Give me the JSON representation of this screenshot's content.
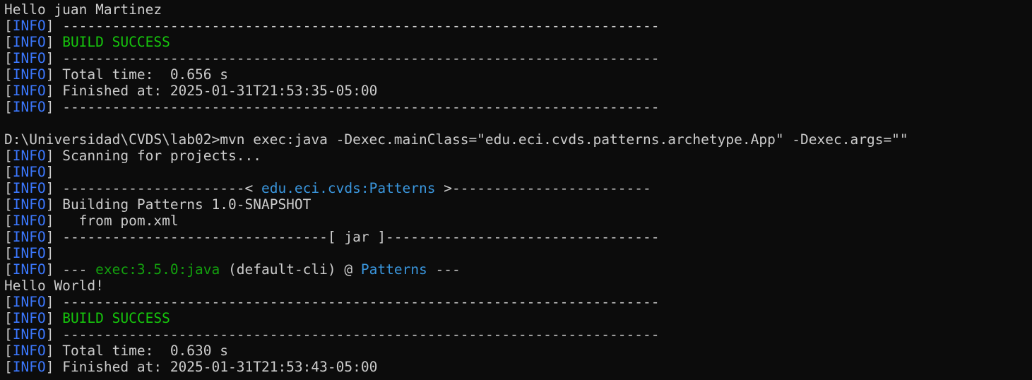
{
  "window": {
    "type": "terminal",
    "background": "#0c0c0c"
  },
  "colors": {
    "default": "#cccccc",
    "info_tag": "#3b78ff",
    "success": "#16c60c",
    "artifact": "#3a96dd",
    "plugin": "#13a10e"
  },
  "lines": [
    [
      {
        "t": "Hello juan Martinez",
        "c": "default"
      }
    ],
    [
      {
        "t": "[",
        "c": "default"
      },
      {
        "t": "INFO",
        "c": "blue"
      },
      {
        "t": "] ------------------------------------------------------------------------",
        "c": "default"
      }
    ],
    [
      {
        "t": "[",
        "c": "default"
      },
      {
        "t": "INFO",
        "c": "blue"
      },
      {
        "t": "] ",
        "c": "default"
      },
      {
        "t": "BUILD SUCCESS",
        "c": "green"
      }
    ],
    [
      {
        "t": "[",
        "c": "default"
      },
      {
        "t": "INFO",
        "c": "blue"
      },
      {
        "t": "] ------------------------------------------------------------------------",
        "c": "default"
      }
    ],
    [
      {
        "t": "[",
        "c": "default"
      },
      {
        "t": "INFO",
        "c": "blue"
      },
      {
        "t": "] Total time:  0.656 s",
        "c": "default"
      }
    ],
    [
      {
        "t": "[",
        "c": "default"
      },
      {
        "t": "INFO",
        "c": "blue"
      },
      {
        "t": "] Finished at: 2025-01-31T21:53:35-05:00",
        "c": "default"
      }
    ],
    [
      {
        "t": "[",
        "c": "default"
      },
      {
        "t": "INFO",
        "c": "blue"
      },
      {
        "t": "] ------------------------------------------------------------------------",
        "c": "default"
      }
    ],
    [
      {
        "t": "",
        "c": "default"
      }
    ],
    [
      {
        "t": "D:\\Universidad\\CVDS\\lab02>mvn exec:java -Dexec.mainClass=\"edu.eci.cvds.patterns.archetype.App\" -Dexec.args=\"\"",
        "c": "default"
      }
    ],
    [
      {
        "t": "[",
        "c": "default"
      },
      {
        "t": "INFO",
        "c": "blue"
      },
      {
        "t": "] Scanning for projects...",
        "c": "default"
      }
    ],
    [
      {
        "t": "[",
        "c": "default"
      },
      {
        "t": "INFO",
        "c": "blue"
      },
      {
        "t": "]",
        "c": "default"
      }
    ],
    [
      {
        "t": "[",
        "c": "default"
      },
      {
        "t": "INFO",
        "c": "blue"
      },
      {
        "t": "] ----------------------< ",
        "c": "default"
      },
      {
        "t": "edu.eci.cvds:Patterns",
        "c": "cyan"
      },
      {
        "t": " >------------------------",
        "c": "default"
      }
    ],
    [
      {
        "t": "[",
        "c": "default"
      },
      {
        "t": "INFO",
        "c": "blue"
      },
      {
        "t": "] Building Patterns 1.0-SNAPSHOT",
        "c": "default"
      }
    ],
    [
      {
        "t": "[",
        "c": "default"
      },
      {
        "t": "INFO",
        "c": "blue"
      },
      {
        "t": "]   from pom.xml",
        "c": "default"
      }
    ],
    [
      {
        "t": "[",
        "c": "default"
      },
      {
        "t": "INFO",
        "c": "blue"
      },
      {
        "t": "] --------------------------------[ jar ]---------------------------------",
        "c": "default"
      }
    ],
    [
      {
        "t": "[",
        "c": "default"
      },
      {
        "t": "INFO",
        "c": "blue"
      },
      {
        "t": "]",
        "c": "default"
      }
    ],
    [
      {
        "t": "[",
        "c": "default"
      },
      {
        "t": "INFO",
        "c": "blue"
      },
      {
        "t": "] --- ",
        "c": "default"
      },
      {
        "t": "exec:3.5.0:java",
        "c": "dim-green"
      },
      {
        "t": " (default-cli) @ ",
        "c": "default"
      },
      {
        "t": "Patterns",
        "c": "cyan"
      },
      {
        "t": " ---",
        "c": "default"
      }
    ],
    [
      {
        "t": "Hello World!",
        "c": "default"
      }
    ],
    [
      {
        "t": "[",
        "c": "default"
      },
      {
        "t": "INFO",
        "c": "blue"
      },
      {
        "t": "] ------------------------------------------------------------------------",
        "c": "default"
      }
    ],
    [
      {
        "t": "[",
        "c": "default"
      },
      {
        "t": "INFO",
        "c": "blue"
      },
      {
        "t": "] ",
        "c": "default"
      },
      {
        "t": "BUILD SUCCESS",
        "c": "green"
      }
    ],
    [
      {
        "t": "[",
        "c": "default"
      },
      {
        "t": "INFO",
        "c": "blue"
      },
      {
        "t": "] ------------------------------------------------------------------------",
        "c": "default"
      }
    ],
    [
      {
        "t": "[",
        "c": "default"
      },
      {
        "t": "INFO",
        "c": "blue"
      },
      {
        "t": "] Total time:  0.630 s",
        "c": "default"
      }
    ],
    [
      {
        "t": "[",
        "c": "default"
      },
      {
        "t": "INFO",
        "c": "blue"
      },
      {
        "t": "] Finished at: 2025-01-31T21:53:43-05:00",
        "c": "default"
      }
    ]
  ]
}
